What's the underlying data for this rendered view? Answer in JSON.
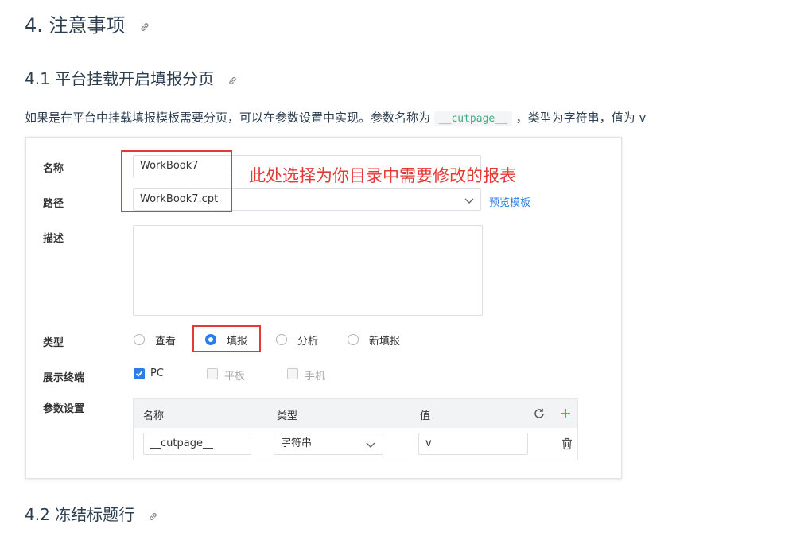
{
  "doc": {
    "h2": "4. 注意事项",
    "h3_first": "4.1 平台挂载开启填报分页",
    "para_before": "如果是在平台中挂载填报模板需要分页，可以在参数设置中实现。参数名称为",
    "para_code": "__cutpage__",
    "para_after": "，类型为字符串，值为 v",
    "h3_second": "4.2 冻结标题行"
  },
  "form": {
    "name_label": "名称",
    "name_value": "WorkBook7",
    "path_label": "路径",
    "path_value": "WorkBook7.cpt",
    "preview_link": "预览模板",
    "desc_label": "描述",
    "type_label": "类型",
    "type_options": [
      "查看",
      "填报",
      "分析",
      "新填报"
    ],
    "selected_type": "填报",
    "terminal_label": "展示终端",
    "terminals": [
      "PC",
      "平板",
      "手机"
    ],
    "params_label": "参数设置",
    "params": {
      "headers": [
        "名称",
        "类型",
        "值"
      ],
      "row": {
        "name": "__cutpage__",
        "type": "字符串",
        "value": "v"
      }
    }
  },
  "annotation": "此处选择为你目录中需要修改的报表",
  "icons": [
    "link-icon",
    "chevron-down-icon",
    "refresh-icon",
    "plus-icon",
    "trash-icon"
  ],
  "colors": {
    "accent": "#2b7de9",
    "annotation": "#e53935",
    "code": "#3eaf7c",
    "add": "#3eaf4f"
  }
}
